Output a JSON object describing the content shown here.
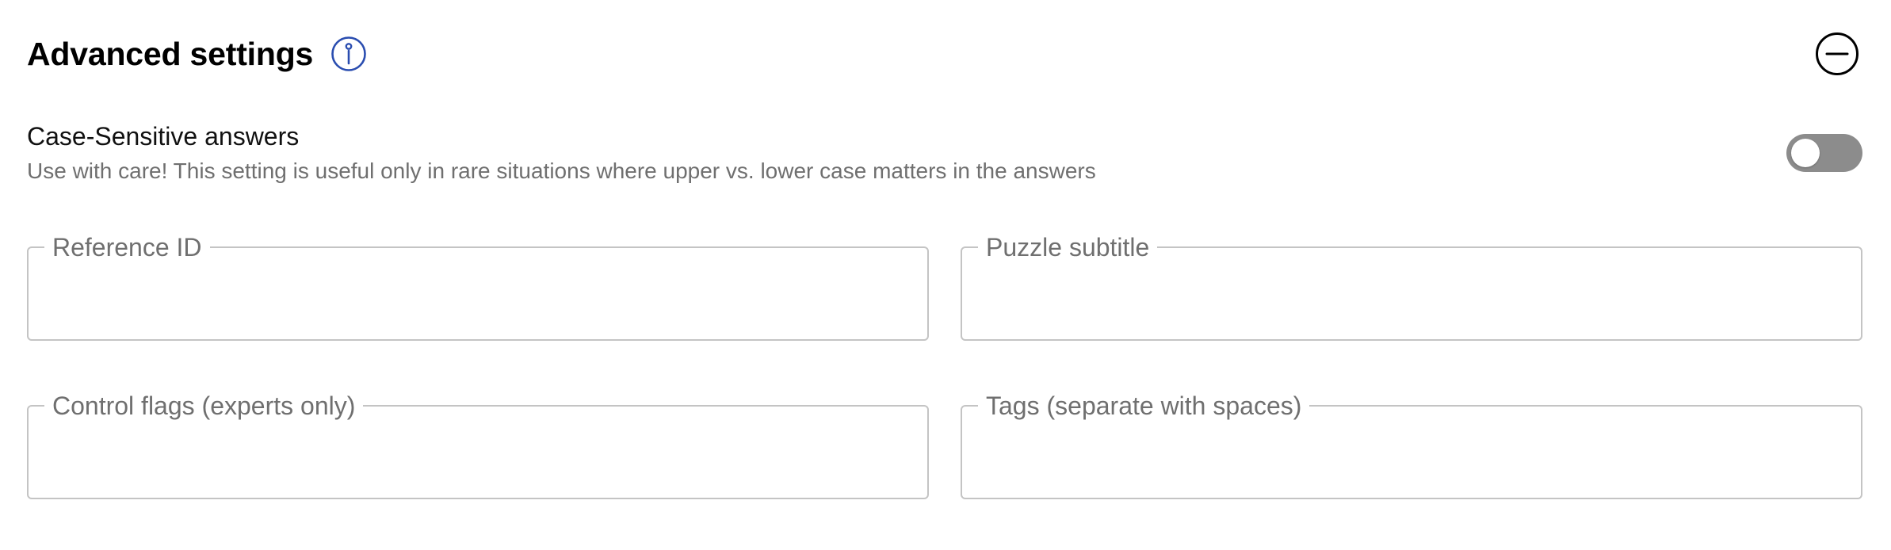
{
  "header": {
    "title": "Advanced settings",
    "info_icon": "info-circle-icon",
    "collapse_icon": "minus-circle-icon",
    "accent_color": "#2a4db0"
  },
  "case_sensitive": {
    "title": "Case-Sensitive answers",
    "description": "Use with care! This setting is useful only in rare situations where upper vs. lower case matters in the answers",
    "enabled": false
  },
  "fields": {
    "reference_id": {
      "label": "Reference ID",
      "value": ""
    },
    "puzzle_subtitle": {
      "label": "Puzzle subtitle",
      "value": ""
    },
    "control_flags": {
      "label": "Control flags (experts only)",
      "value": ""
    },
    "tags": {
      "label": "Tags (separate with spaces)",
      "value": ""
    }
  }
}
